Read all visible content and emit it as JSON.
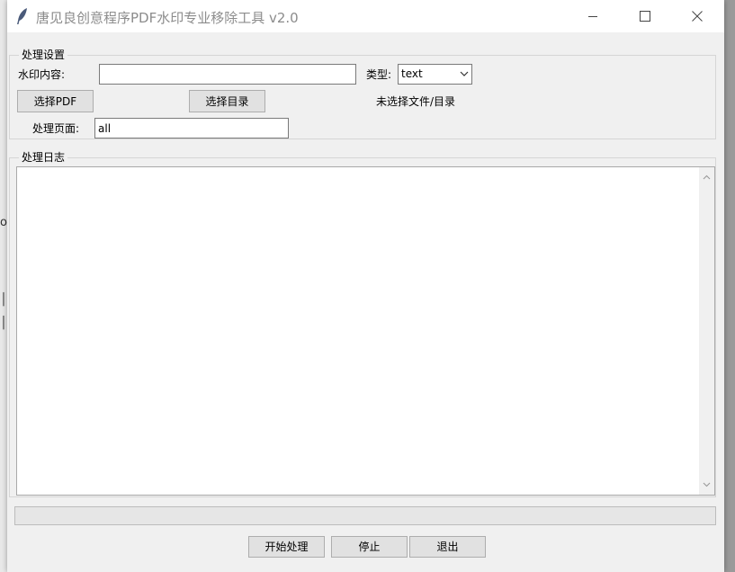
{
  "window": {
    "title": "唐见良创意程序PDF水印专业移除工具 v2.0",
    "icon": "feather-icon",
    "controls": [
      "minimize-icon",
      "maximize-icon",
      "close-icon"
    ]
  },
  "settings": {
    "group_label": "处理设置",
    "watermark_label": "水印内容:",
    "watermark_value": "",
    "type_label": "类型:",
    "type_value": "text",
    "select_pdf": "选择PDF",
    "select_dir": "选择目录",
    "selection_status": "未选择文件/目录",
    "pages_label": "处理页面:",
    "pages_value": "all"
  },
  "log": {
    "group_label": "处理日志",
    "content": ""
  },
  "progress": {
    "value": 0
  },
  "actions": {
    "start": "开始处理",
    "stop": "停止",
    "exit": "退出"
  },
  "colors": {
    "window_bg": "#f0f0f0",
    "titlebar_bg": "#ffffff",
    "title_text": "#8c8c8c",
    "button_bg": "#e1e1e1",
    "icon_blue": "#4a5a7a"
  }
}
